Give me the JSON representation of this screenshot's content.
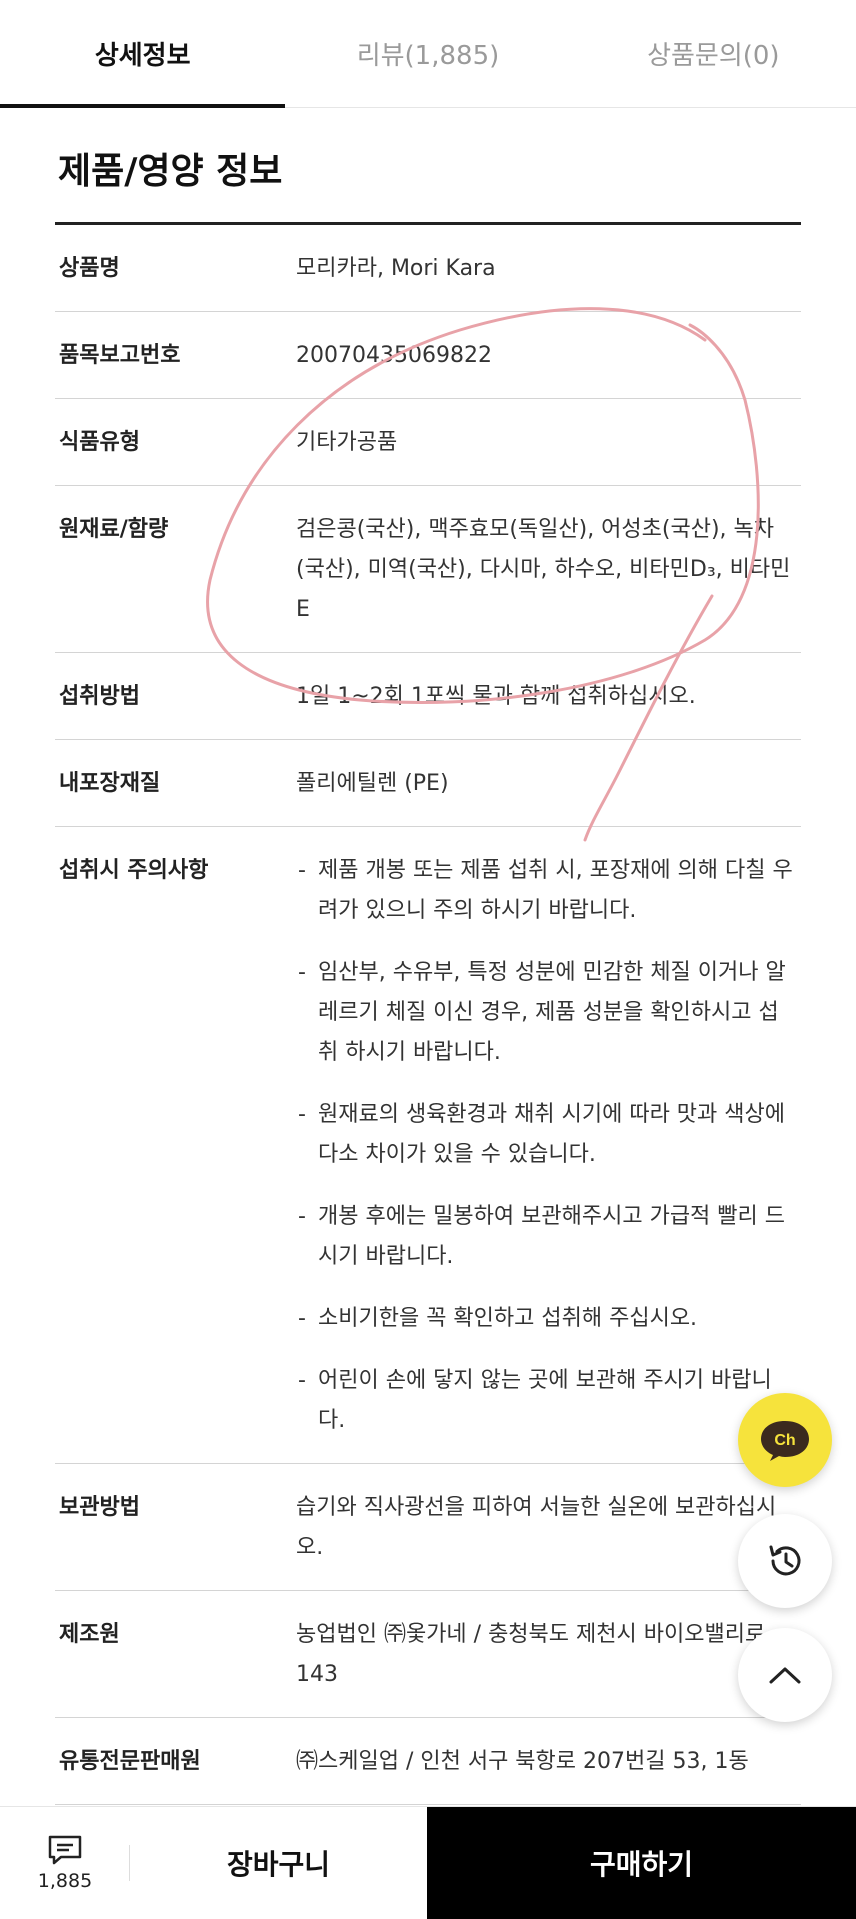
{
  "tabs": [
    {
      "label": "상세정보"
    },
    {
      "label": "리뷰(1,885)"
    },
    {
      "label": "상품문의(0)"
    }
  ],
  "section_title": "제품/영양 정보",
  "rows": [
    {
      "key": "상품명",
      "value": "모리카라, Mori Kara"
    },
    {
      "key": "품목보고번호",
      "value": "20070435069822"
    },
    {
      "key": "식품유형",
      "value": "기타가공품"
    },
    {
      "key": "원재료/함량",
      "value": "검은콩(국산), 맥주효모(독일산), 어성초(국산), 녹차(국산), 미역(국산), 다시마, 하수오, 비타민D₃, 비타민E"
    },
    {
      "key": "섭취방법",
      "value": "1일 1~2회 1포씩 물과 함께 섭취하십시오."
    },
    {
      "key": "내포장재질",
      "value": "폴리에틸렌 (PE)"
    },
    {
      "key": "섭취시 주의사항"
    },
    {
      "key": "보관방법",
      "value": "습기와 직사광선을 피하여 서늘한 실온에 보관하십시오."
    },
    {
      "key": "제조원",
      "value": "농업법인 ㈜옻가네 / 충청북도 제천시 바이오밸리로 143"
    },
    {
      "key": "유통전문판매원",
      "value": "㈜스케일업 / 인천 서구 북항로 207번길 53, 1동"
    }
  ],
  "cautions": [
    "제품 개봉 또는 제품 섭취 시, 포장재에 의해 다칠 우려가 있으니 주의 하시기 바랍니다.",
    "임산부, 수유부, 특정 성분에 민감한 체질 이거나 알레르기 체질 이신 경우, 제품 성분을 확인하시고 섭취 하시기 바랍니다.",
    "원재료의 생육환경과 채취 시기에 따라 맛과 색상에 다소 차이가 있을 수 있습니다.",
    "개봉 후에는 밀봉하여 보관해주시고 가급적 빨리 드시기 바랍니다.",
    "소비기한을 꼭 확인하고 섭취해 주십시오.",
    "어린이 손에 닿지 않는 곳에 보관해 주시기 바랍니다."
  ],
  "fabs": {
    "chat_label": "Ch",
    "chat_color": "#f6e33c"
  },
  "bottom_bar": {
    "review_count": "1,885",
    "cart_label": "장바구니",
    "buy_label": "구매하기"
  },
  "colors": {
    "annotation": "#e8a2a8",
    "buy_bg": "#000000"
  }
}
